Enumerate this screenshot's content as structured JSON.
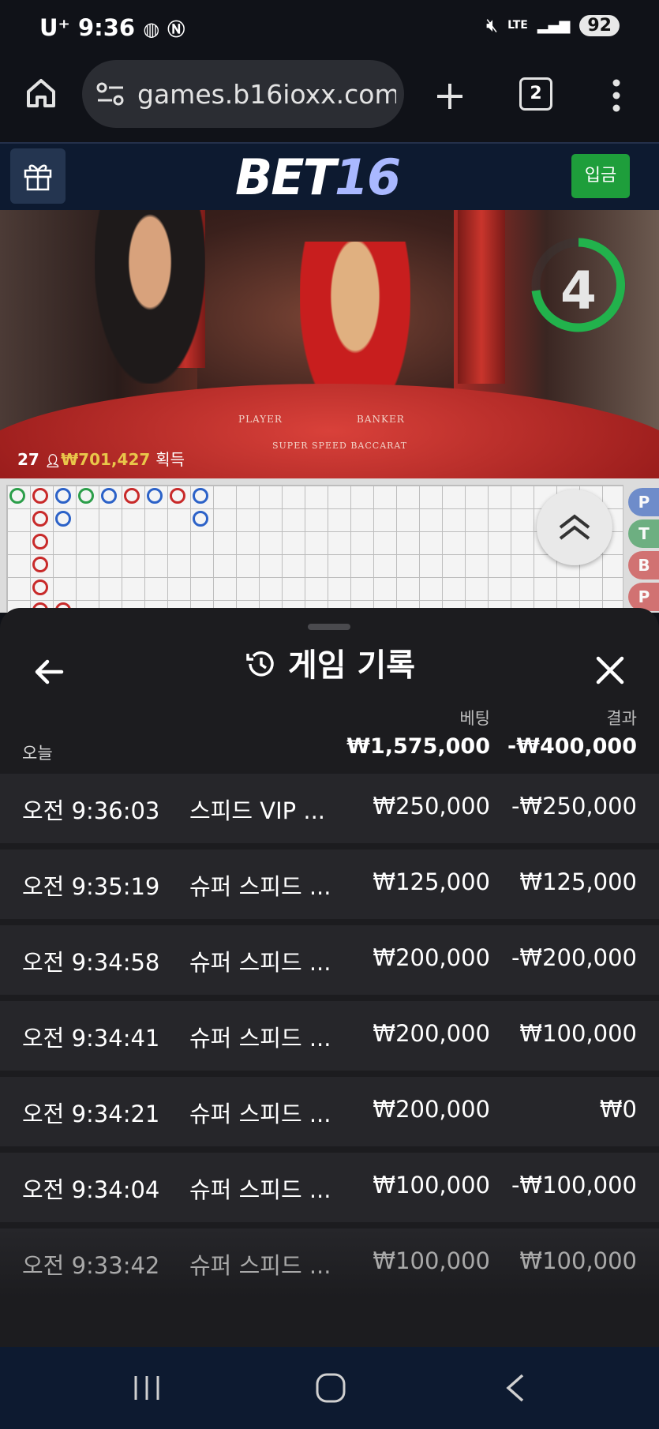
{
  "status_bar": {
    "carrier": "U⁺",
    "time": "9:36",
    "network": "LTE",
    "battery": "92"
  },
  "browser": {
    "url": "games.b16ioxx.com/",
    "tab_count": "2"
  },
  "site": {
    "logo_main": "BET",
    "logo_num": "16",
    "deposit_label": "입금"
  },
  "video": {
    "timer": "4",
    "player_count": "27",
    "win_amount": "₩701,427",
    "win_suffix": "획득",
    "felt_player": "PLAYER",
    "felt_banker": "BANKER",
    "felt_game": "SUPER SPEED BACCARAT"
  },
  "scoreboard": {
    "side_buttons": [
      "P",
      "T",
      "B",
      "P"
    ]
  },
  "history": {
    "title": "게임 기록",
    "col_bet": "베팅",
    "col_result": "결과",
    "today_label": "오늘",
    "total_bet": "₩1,575,000",
    "total_result": "-₩400,000",
    "rows": [
      {
        "time": "오전 9:36:03",
        "game": "스피드 VIP ...",
        "bet": "₩250,000",
        "result": "-₩250,000"
      },
      {
        "time": "오전 9:35:19",
        "game": "슈퍼 스피드 ...",
        "bet": "₩125,000",
        "result": "₩125,000"
      },
      {
        "time": "오전 9:34:58",
        "game": "슈퍼 스피드 ...",
        "bet": "₩200,000",
        "result": "-₩200,000"
      },
      {
        "time": "오전 9:34:41",
        "game": "슈퍼 스피드 ...",
        "bet": "₩200,000",
        "result": "₩100,000"
      },
      {
        "time": "오전 9:34:21",
        "game": "슈퍼 스피드 ...",
        "bet": "₩200,000",
        "result": "₩0"
      },
      {
        "time": "오전 9:34:04",
        "game": "슈퍼 스피드 ...",
        "bet": "₩100,000",
        "result": "-₩100,000"
      },
      {
        "time": "오전 9:33:42",
        "game": "슈퍼 스피드 ...",
        "bet": "₩100,000",
        "result": "₩100,000"
      }
    ]
  },
  "icons": [
    "home-icon",
    "site-settings-icon",
    "new-tab-icon",
    "tabs-icon",
    "menu-icon",
    "gift-icon",
    "history-icon",
    "back-arrow-icon",
    "close-icon",
    "chevrons-up-icon",
    "recents-icon",
    "home-nav-icon",
    "back-nav-icon"
  ]
}
